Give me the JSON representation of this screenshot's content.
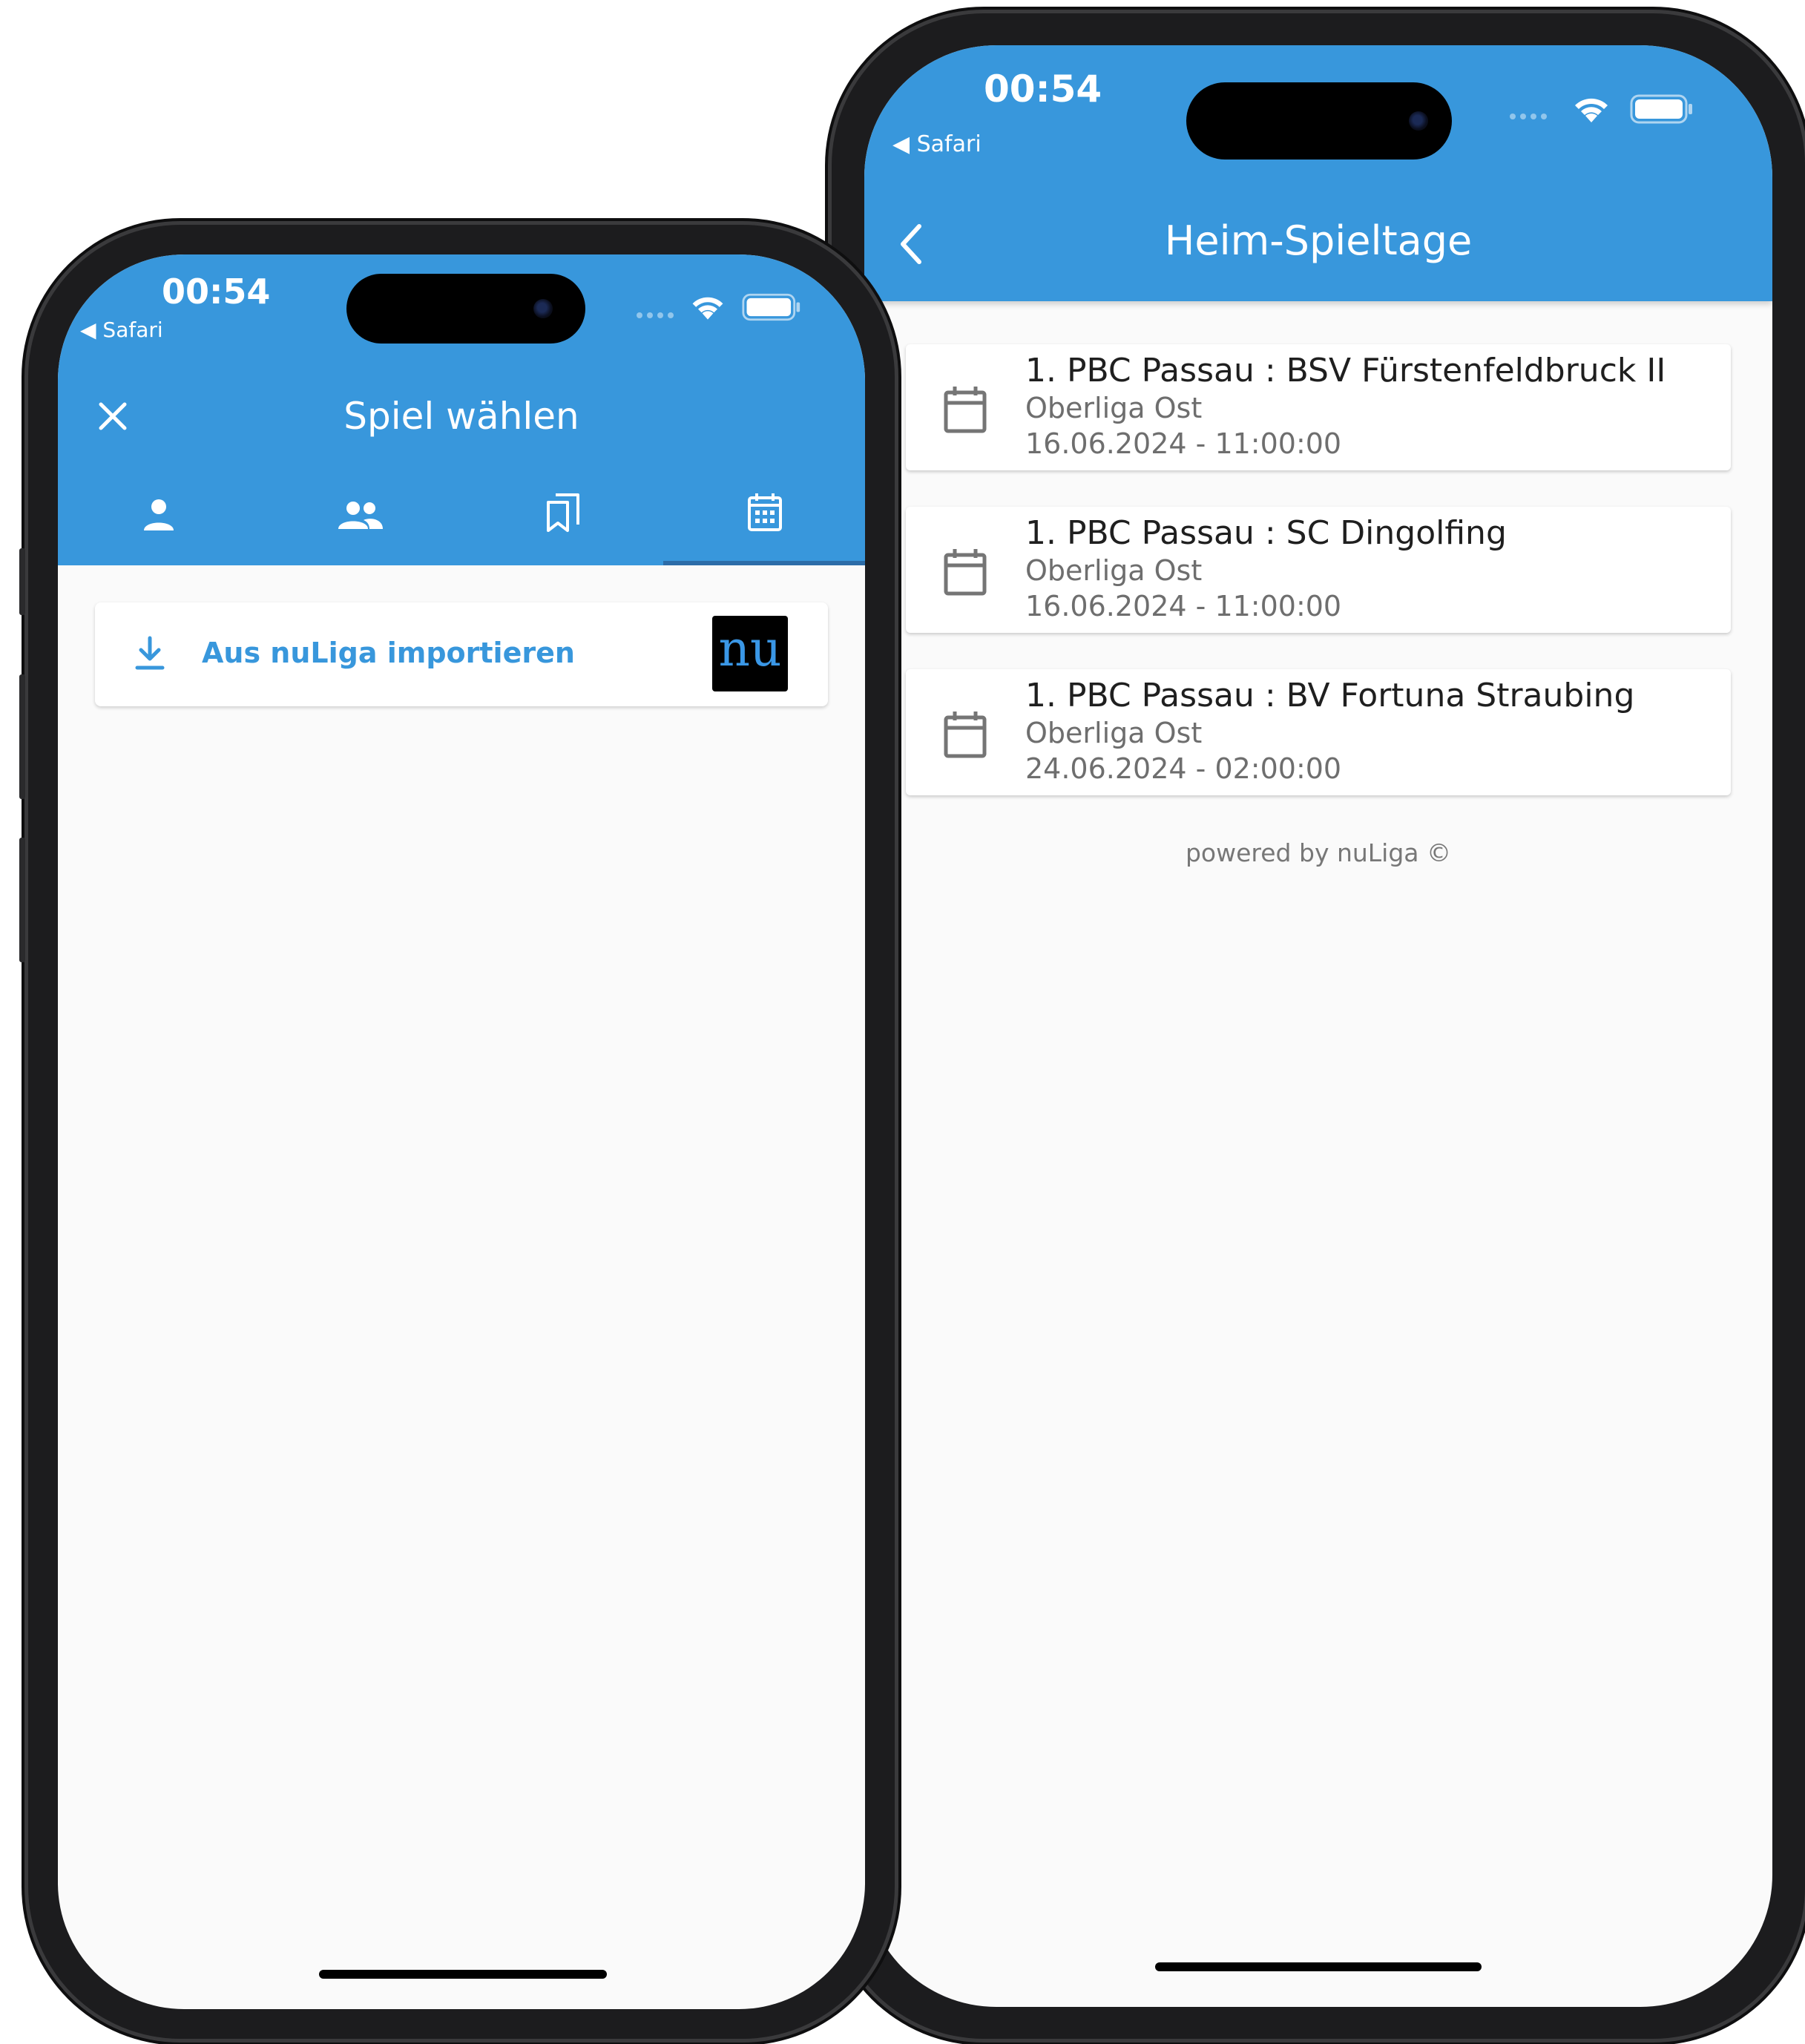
{
  "status_bar": {
    "time": "00:54",
    "back_app": "◀ Safari"
  },
  "left_screen": {
    "title": "Spiel wählen",
    "tabs": [
      {
        "icon": "person-icon"
      },
      {
        "icon": "group-icon"
      },
      {
        "icon": "bookmarks-icon"
      },
      {
        "icon": "calendar-icon",
        "selected": true
      }
    ],
    "import_button": {
      "label": "Aus nuLiga importieren",
      "logo_text": "nu"
    }
  },
  "right_screen": {
    "title": "Heim-Spieltage",
    "matches": [
      {
        "title": "1. PBC Passau : BSV Fürstenfeldbruck II",
        "league": "Oberliga Ost",
        "datetime": "16.06.2024 - 11:00:00"
      },
      {
        "title": "1. PBC Passau : SC Dingolfing",
        "league": "Oberliga Ost",
        "datetime": "16.06.2024 - 11:00:00"
      },
      {
        "title": "1. PBC Passau : BV Fortuna Straubing",
        "league": "Oberliga Ost",
        "datetime": "24.06.2024 - 02:00:00"
      }
    ],
    "footer": "powered by nuLiga ©"
  },
  "colors": {
    "primary": "#3897dc",
    "tab_indicator": "#2c6ca8",
    "background": "#fafafa",
    "logo_bg": "#000000",
    "logo_text": "#3a97e6"
  }
}
